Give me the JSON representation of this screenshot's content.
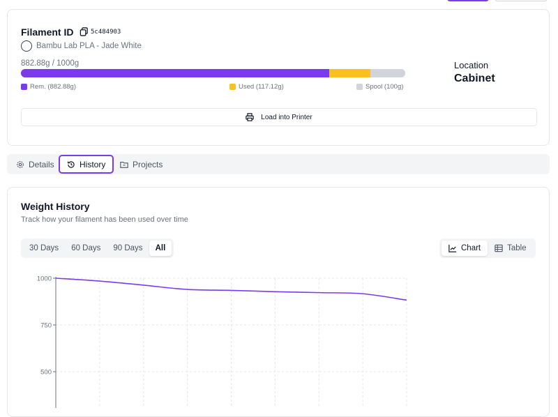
{
  "filament": {
    "title": "Filament ID",
    "id": "5c484903",
    "name": "Bambu Lab PLA - Jade White",
    "swatch_color": "#ffffff",
    "weight_text": "882.88g / 1000g",
    "remaining_g": 882.88,
    "used_g": 117.12,
    "spool_g": 100,
    "legend": {
      "remaining": "Rem. (882.88g)",
      "used": "Used (117.12g)",
      "spool": "Spool (100g)"
    },
    "colors": {
      "remaining": "#7c3aed",
      "used": "#fbbf24",
      "spool": "#d1d5db"
    }
  },
  "location": {
    "label": "Location",
    "value": "Cabinet"
  },
  "actions": {
    "load_label": "Load into Printer"
  },
  "tabs": [
    {
      "label": "Details",
      "icon": "gear-icon"
    },
    {
      "label": "History",
      "icon": "history-icon",
      "active": true
    },
    {
      "label": "Projects",
      "icon": "folder-icon"
    }
  ],
  "history": {
    "title": "Weight History",
    "subtitle": "Track how your filament has been used over time",
    "ranges": [
      "30 Days",
      "60 Days",
      "90 Days",
      "All"
    ],
    "active_range": "All",
    "views": [
      "Chart",
      "Table"
    ],
    "active_view": "Chart"
  },
  "chart_data": {
    "type": "line",
    "title": "",
    "xlabel": "",
    "ylabel": "",
    "ylim": [
      250,
      1000
    ],
    "y_ticks": [
      1000,
      750,
      500
    ],
    "grid": true,
    "line_color": "#7c3aed",
    "series": [
      {
        "values": [
          1000,
          985,
          963,
          940,
          935,
          928,
          923,
          917,
          882.88
        ]
      }
    ]
  }
}
